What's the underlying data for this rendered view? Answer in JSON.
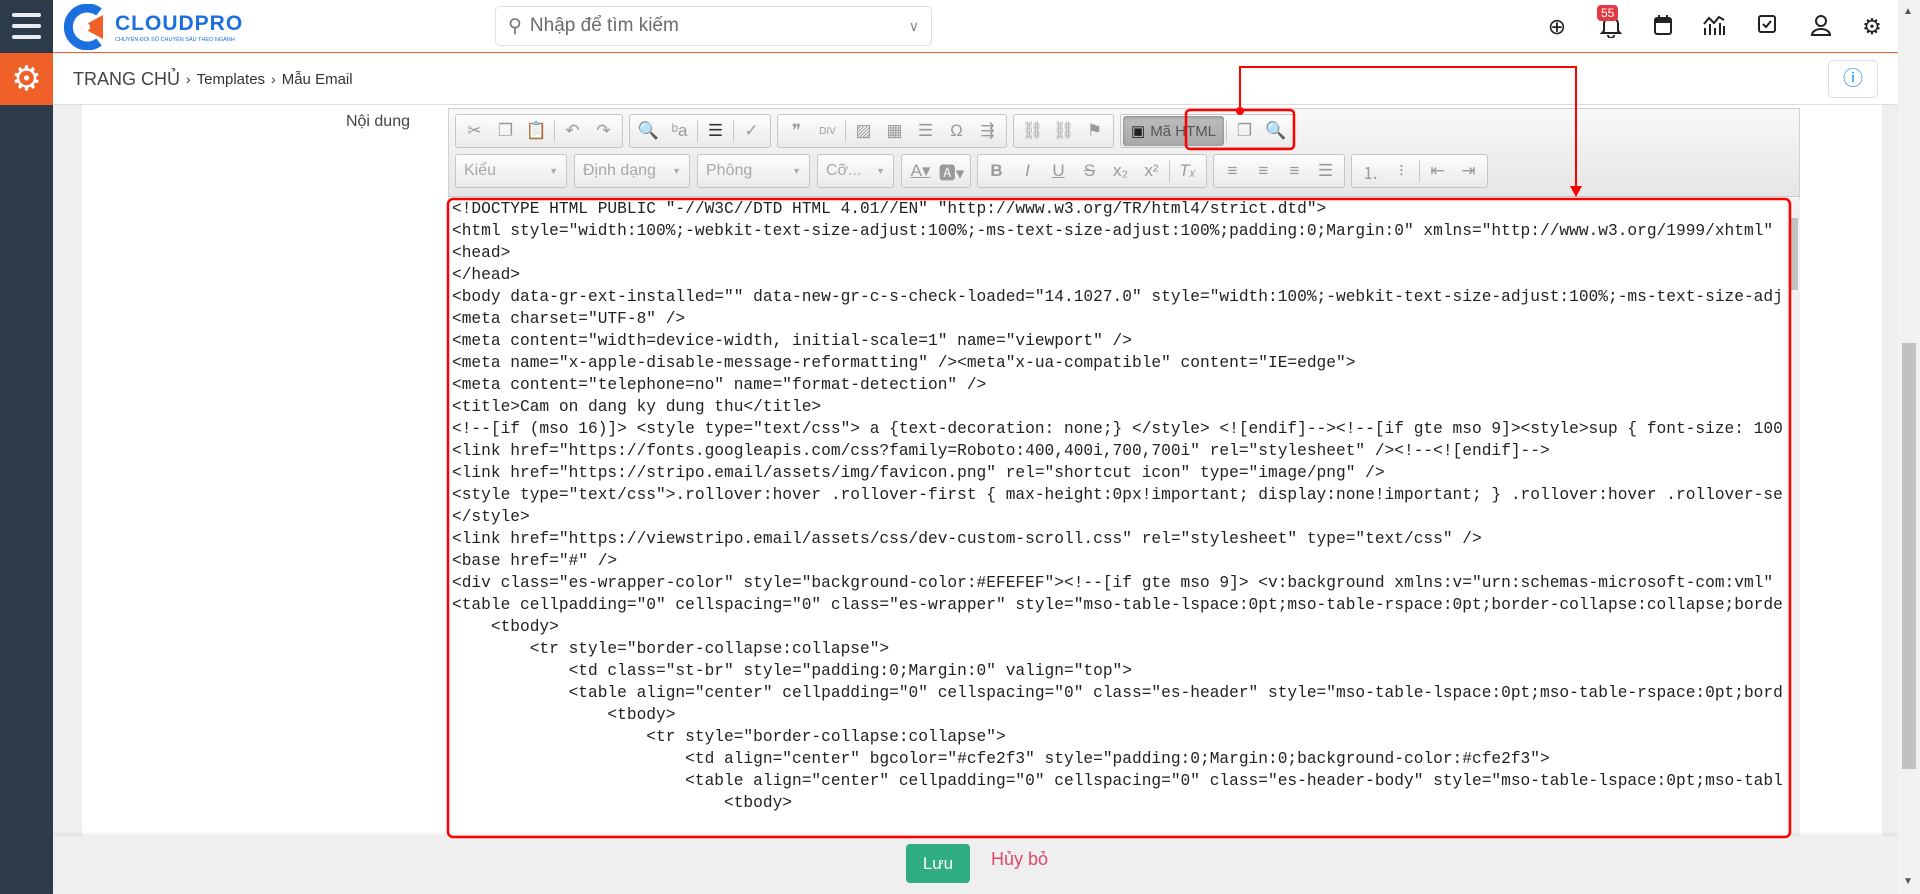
{
  "app": {
    "logo_name": "CLOUDPRO",
    "logo_tagline": "CHUYỂN ĐỔI SỐ CHUYÊN SÂU THEO NGÀNH",
    "brand_color": "#1d6fe0",
    "accent_color": "#f0612a"
  },
  "search": {
    "placeholder": "Nhập để tìm kiếm"
  },
  "header_icons": [
    "plus-circle-icon",
    "bell-icon",
    "calendar-icon",
    "chart-icon",
    "checkbox-icon",
    "user-icon",
    "gear-icon"
  ],
  "notifications": {
    "count": "55"
  },
  "breadcrumb": {
    "home": "TRANG CHỦ",
    "items": [
      "Templates",
      "Mẫu Email"
    ]
  },
  "form": {
    "content_label": "Nội dung"
  },
  "toolbar": {
    "source_label": "Mã HTML",
    "combos": [
      "Kiểu",
      "Định dạng",
      "Phông",
      "Cỡ..."
    ]
  },
  "code_lines": [
    "<!DOCTYPE HTML PUBLIC \"-//W3C//DTD HTML 4.01//EN\" \"http://www.w3.org/TR/html4/strict.dtd\">",
    "<html style=\"width:100%;-webkit-text-size-adjust:100%;-ms-text-size-adjust:100%;padding:0;Margin:0\" xmlns=\"http://www.w3.org/1999/xhtml\"",
    "<head>",
    "</head>",
    "<body data-gr-ext-installed=\"\" data-new-gr-c-s-check-loaded=\"14.1027.0\" style=\"width:100%;-webkit-text-size-adjust:100%;-ms-text-size-adj",
    "<meta charset=\"UTF-8\" />",
    "<meta content=\"width=device-width, initial-scale=1\" name=\"viewport\" />",
    "<meta name=\"x-apple-disable-message-reformatting\" /><meta\"x-ua-compatible\" content=\"IE=edge\">",
    "<meta content=\"telephone=no\" name=\"format-detection\" />",
    "<title>Cam on dang ky dung thu</title>",
    "<!--[if (mso 16)]> <style type=\"text/css\"> a {text-decoration: none;} </style> <![endif]--><!--[if gte mso 9]><style>sup { font-size: 100",
    "<link href=\"https://fonts.googleapis.com/css?family=Roboto:400,400i,700,700i\" rel=\"stylesheet\" /><!--<![endif]-->",
    "<link href=\"https://stripo.email/assets/img/favicon.png\" rel=\"shortcut icon\" type=\"image/png\" />",
    "<style type=\"text/css\">.rollover:hover .rollover-first { max-height:0px!important; display:none!important; } .rollover:hover .rollover-se",
    "</style>",
    "<link href=\"https://viewstripo.email/assets/css/dev-custom-scroll.css\" rel=\"stylesheet\" type=\"text/css\" />",
    "<base href=\"#\" />",
    "<div class=\"es-wrapper-color\" style=\"background-color:#EFEFEF\"><!--[if gte mso 9]> <v:background xmlns:v=\"urn:schemas-microsoft-com:vml\"",
    "<table cellpadding=\"0\" cellspacing=\"0\" class=\"es-wrapper\" style=\"mso-table-lspace:0pt;mso-table-rspace:0pt;border-collapse:collapse;borde",
    "    <tbody>",
    "        <tr style=\"border-collapse:collapse\">",
    "            <td class=\"st-br\" style=\"padding:0;Margin:0\" valign=\"top\">",
    "            <table align=\"center\" cellpadding=\"0\" cellspacing=\"0\" class=\"es-header\" style=\"mso-table-lspace:0pt;mso-table-rspace:0pt;bord",
    "                <tbody>",
    "                    <tr style=\"border-collapse:collapse\">",
    "                        <td align=\"center\" bgcolor=\"#cfe2f3\" style=\"padding:0;Margin:0;background-color:#cfe2f3\">",
    "                        <table align=\"center\" cellpadding=\"0\" cellspacing=\"0\" class=\"es-header-body\" style=\"mso-table-lspace:0pt;mso-tabl",
    "                            <tbody>"
  ],
  "actions": {
    "save": "Lưu",
    "cancel": "Hủy bỏ",
    "save_color": "#30ae82",
    "cancel_color": "#e1476a"
  },
  "annotation_color": "#ff0000"
}
